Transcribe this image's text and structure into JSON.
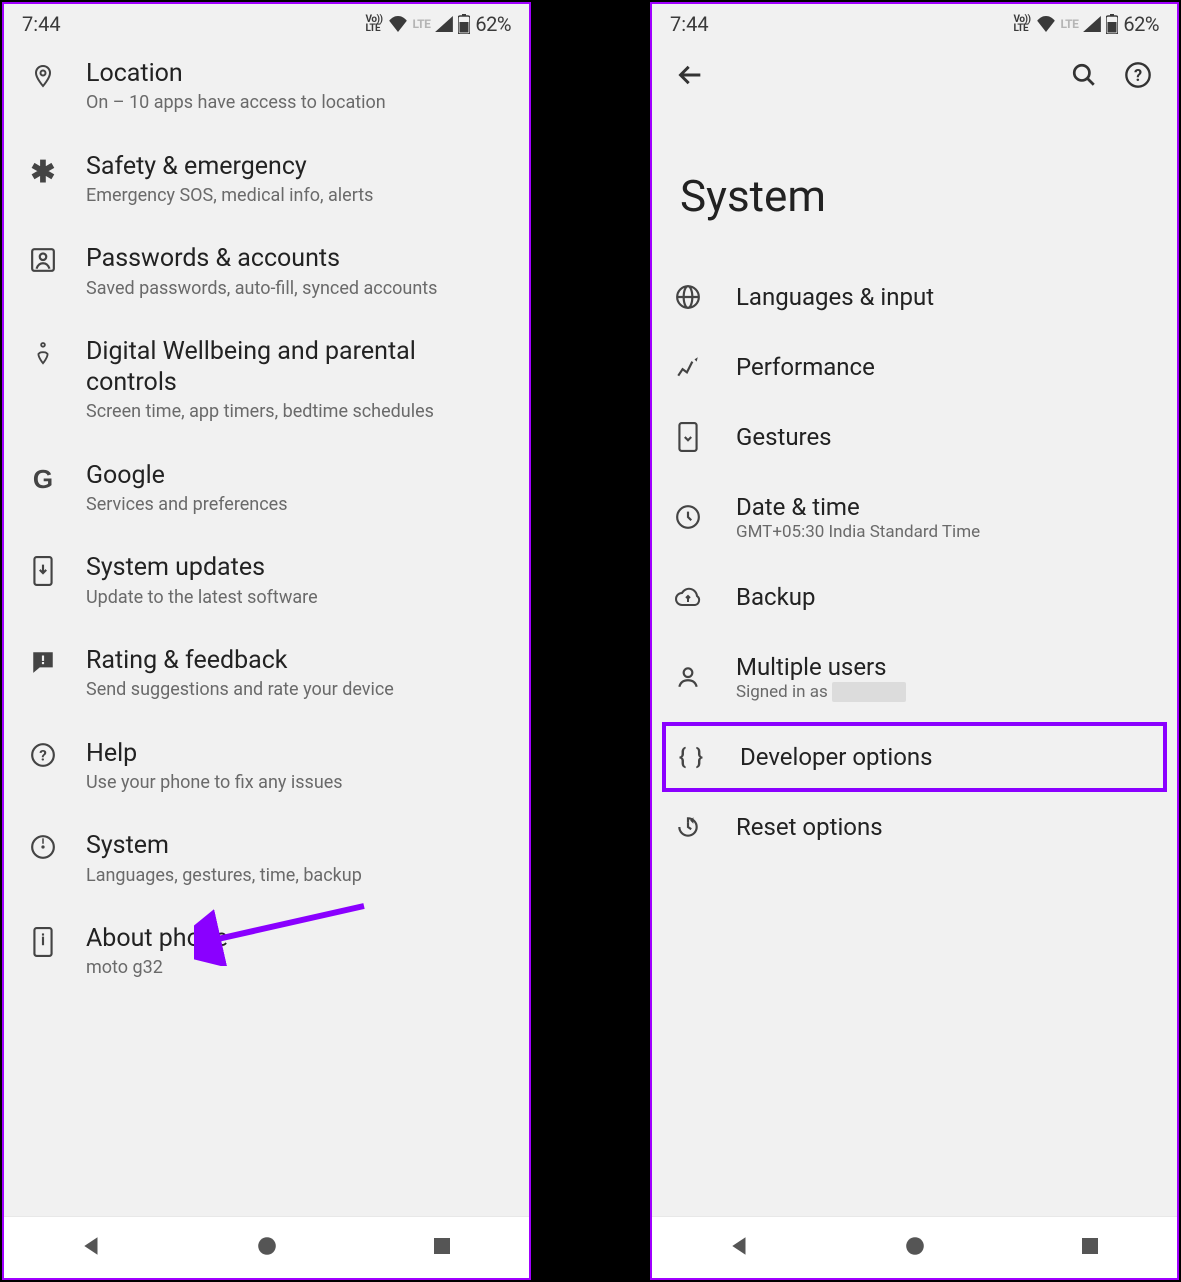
{
  "status": {
    "time": "7:44",
    "volte": "Vo))\nLTE",
    "lte": "LTE",
    "battery": "62%"
  },
  "left": {
    "items": [
      {
        "icon": "location-icon",
        "title": "Location",
        "sub": "On – 10 apps have access to location"
      },
      {
        "icon": "emergency-icon",
        "title": "Safety & emergency",
        "sub": "Emergency SOS, medical info, alerts"
      },
      {
        "icon": "accounts-icon",
        "title": "Passwords & accounts",
        "sub": "Saved passwords, auto-fill, synced accounts"
      },
      {
        "icon": "wellbeing-icon",
        "title": "Digital Wellbeing and parental controls",
        "sub": "Screen time, app timers, bedtime schedules"
      },
      {
        "icon": "google-icon",
        "title": "Google",
        "sub": "Services and preferences"
      },
      {
        "icon": "update-icon",
        "title": "System updates",
        "sub": "Update to the latest software"
      },
      {
        "icon": "feedback-icon",
        "title": "Rating & feedback",
        "sub": "Send suggestions and rate your device"
      },
      {
        "icon": "help-icon",
        "title": "Help",
        "sub": "Use your phone to fix any issues"
      },
      {
        "icon": "system-icon",
        "title": "System",
        "sub": "Languages, gestures, time, backup"
      },
      {
        "icon": "about-icon",
        "title": "About phone",
        "sub": "moto g32"
      }
    ]
  },
  "right": {
    "page_title": "System",
    "items": [
      {
        "icon": "globe-icon",
        "title": "Languages & input",
        "sub": ""
      },
      {
        "icon": "performance-icon",
        "title": "Performance",
        "sub": ""
      },
      {
        "icon": "gestures-icon",
        "title": "Gestures",
        "sub": ""
      },
      {
        "icon": "clock-icon",
        "title": "Date & time",
        "sub": "GMT+05:30 India Standard Time"
      },
      {
        "icon": "cloud-icon",
        "title": "Backup",
        "sub": ""
      },
      {
        "icon": "users-icon",
        "title": "Multiple users",
        "sub": "Signed in as "
      },
      {
        "icon": "braces-icon",
        "title": "Developer options",
        "sub": "",
        "hl": true
      },
      {
        "icon": "reset-icon",
        "title": "Reset options",
        "sub": ""
      }
    ]
  }
}
